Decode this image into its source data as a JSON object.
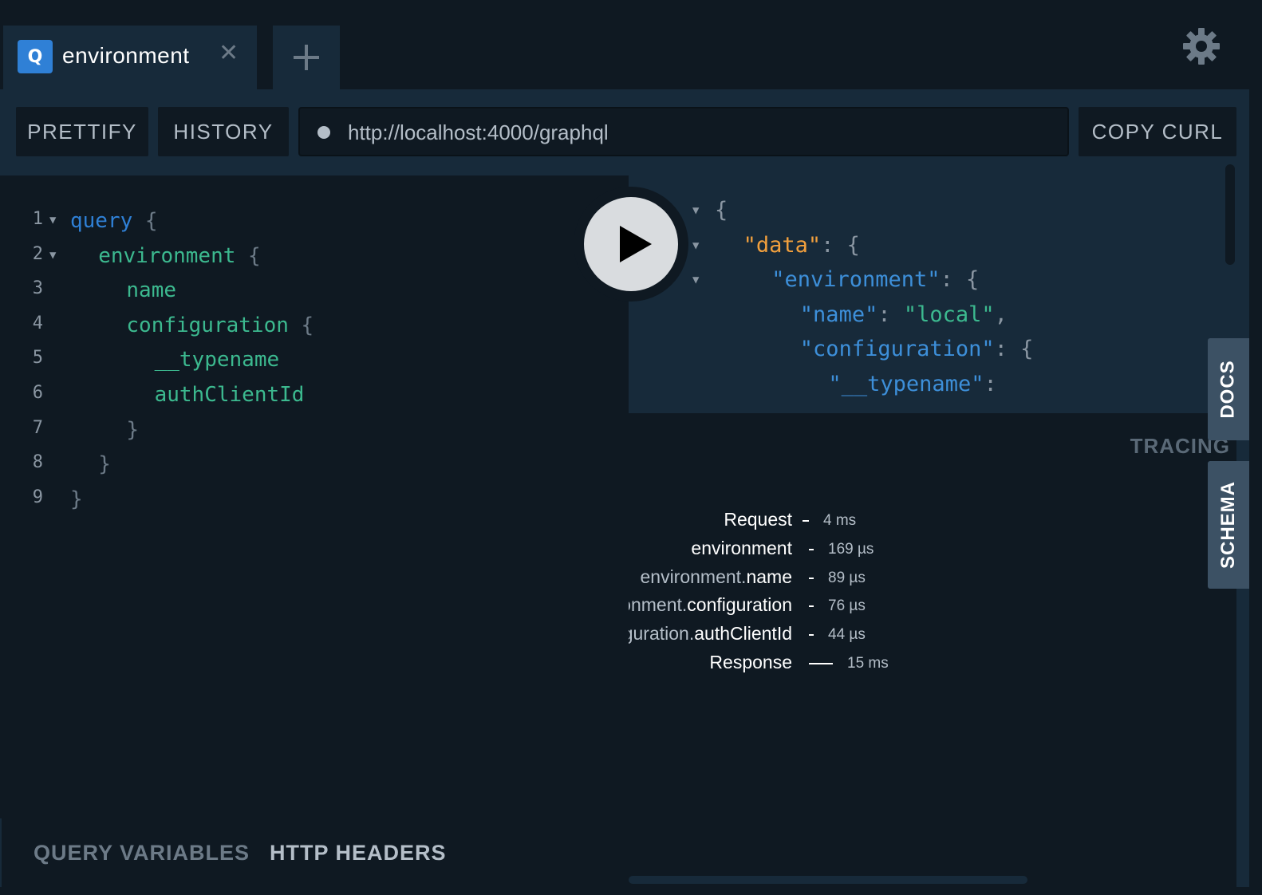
{
  "tab": {
    "badge": "Q",
    "title": "environment",
    "close_glyph": "✕",
    "add_glyph": "+"
  },
  "toolbar": {
    "prettify_label": "PRETTIFY",
    "history_label": "HISTORY",
    "url": "http://localhost:4000/graphql",
    "copy_curl_label": "COPY CURL"
  },
  "editor": {
    "lines": [
      {
        "num": "1",
        "fold": "▼",
        "indent": "",
        "tokens": [
          {
            "t": "query",
            "c": "kw"
          },
          {
            "t": " {",
            "c": "pun"
          }
        ]
      },
      {
        "num": "2",
        "fold": "▼",
        "indent": "  ",
        "tokens": [
          {
            "t": "environment",
            "c": "fld"
          },
          {
            "t": " {",
            "c": "pun"
          }
        ]
      },
      {
        "num": "3",
        "fold": "",
        "indent": "    ",
        "tokens": [
          {
            "t": "name",
            "c": "fld"
          }
        ]
      },
      {
        "num": "4",
        "fold": "",
        "indent": "    ",
        "tokens": [
          {
            "t": "configuration",
            "c": "fld"
          },
          {
            "t": " {",
            "c": "pun"
          }
        ]
      },
      {
        "num": "5",
        "fold": "",
        "indent": "      ",
        "tokens": [
          {
            "t": "__typename",
            "c": "fld"
          }
        ]
      },
      {
        "num": "6",
        "fold": "",
        "indent": "      ",
        "tokens": [
          {
            "t": "authClientId",
            "c": "fld"
          }
        ]
      },
      {
        "num": "7",
        "fold": "",
        "indent": "    ",
        "tokens": [
          {
            "t": "}",
            "c": "pun"
          }
        ]
      },
      {
        "num": "8",
        "fold": "",
        "indent": "  ",
        "tokens": [
          {
            "t": "}",
            "c": "pun"
          }
        ]
      },
      {
        "num": "9",
        "fold": "",
        "indent": "",
        "tokens": [
          {
            "t": "}",
            "c": "pun"
          }
        ]
      }
    ]
  },
  "result": {
    "lines": [
      {
        "fold": "▼",
        "indent": "",
        "tokens": [
          {
            "t": "{",
            "c": "grey"
          }
        ]
      },
      {
        "fold": "▼",
        "indent": "  ",
        "tokens": [
          {
            "t": "\"data\"",
            "c": "orange"
          },
          {
            "t": ": {",
            "c": "grey"
          }
        ]
      },
      {
        "fold": "▼",
        "indent": "    ",
        "tokens": [
          {
            "t": "\"environment\"",
            "c": "blue"
          },
          {
            "t": ": {",
            "c": "grey"
          }
        ]
      },
      {
        "fold": "",
        "indent": "      ",
        "tokens": [
          {
            "t": "\"name\"",
            "c": "blue"
          },
          {
            "t": ": ",
            "c": "grey"
          },
          {
            "t": "\"local\"",
            "c": "green"
          },
          {
            "t": ",",
            "c": "grey"
          }
        ]
      },
      {
        "fold": "",
        "indent": "      ",
        "tokens": [
          {
            "t": "\"configuration\"",
            "c": "blue"
          },
          {
            "t": ": {",
            "c": "grey"
          }
        ]
      },
      {
        "fold": "",
        "indent": "        ",
        "tokens": [
          {
            "t": "\"__typename\"",
            "c": "blue"
          },
          {
            "t": ":",
            "c": "grey"
          }
        ]
      }
    ]
  },
  "tracing": {
    "label": "TRACING",
    "rows": [
      {
        "prefix": "",
        "name": "Request",
        "duration": "4 ms",
        "bar_width": 8
      },
      {
        "prefix": "",
        "name": "environment",
        "duration": "169 µs",
        "bar_width": 6
      },
      {
        "prefix": "environment.",
        "name": "name",
        "duration": "89 µs",
        "bar_width": 6
      },
      {
        "prefix": "environment.",
        "name": "configuration",
        "duration": "76 µs",
        "bar_width": 6
      },
      {
        "prefix": "environment.configuration.",
        "name": "authClientId",
        "duration": "44 µs",
        "bar_width": 6
      },
      {
        "prefix": "",
        "name": "Response",
        "duration": "15 ms",
        "bar_width": 30
      }
    ]
  },
  "bottom_tabs": {
    "query_variables": "QUERY VARIABLES",
    "http_headers": "HTTP HEADERS"
  },
  "side_tabs": {
    "docs": "DOCS",
    "schema": "SCHEMA"
  },
  "colors": {
    "background": "#0f1922",
    "panel": "#172a3a",
    "keyword": "#2f80d6",
    "field": "#3cb98f",
    "json_key_data": "#f2a03d",
    "json_key": "#3d8fd9",
    "badge": "#2f80d6"
  },
  "icons": {
    "settings": "gear-icon",
    "run": "play-icon",
    "url_status": "status-dot-icon"
  }
}
